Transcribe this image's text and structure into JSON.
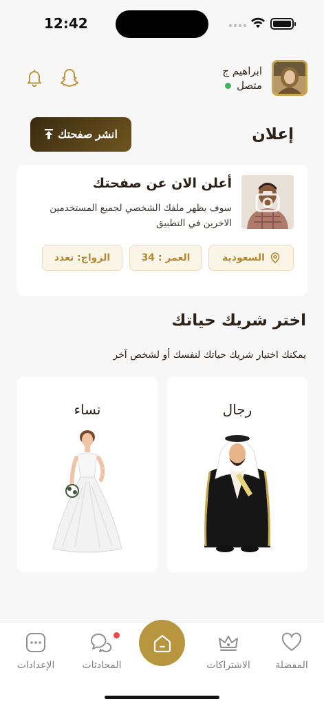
{
  "status_bar": {
    "time": "12:42"
  },
  "header": {
    "user_name": "ابراهيم ج",
    "user_status": "متصل",
    "icons": [
      "snapchat-icon",
      "bell-icon"
    ]
  },
  "ad_section": {
    "title": "إعلان",
    "publish_button": "انشر صفحتك",
    "card": {
      "heading": "أعلن الان عن صفحتك",
      "description": "سوف يظهر ملفك الشخصي لجميع المستخدمين الاخرين في التطبيق",
      "country": "السعودية",
      "age": "العمر : 34",
      "marriage": "الزواج: تعدد"
    }
  },
  "partner_section": {
    "title": "اختر شريك حياتك",
    "subtitle": "يمكنك اختيار شريك حياتك لنفسك أو لشخص آخر",
    "men_label": "رجال",
    "women_label": "نساء"
  },
  "tabbar": {
    "tabs": [
      {
        "label": "المفضلة",
        "icon": "heart-icon"
      },
      {
        "label": "الاشتراكات",
        "icon": "crown-icon"
      },
      {
        "label": "",
        "icon": "home-icon"
      },
      {
        "label": "المحادثات",
        "icon": "chat-icon"
      },
      {
        "label": "الإعدادات",
        "icon": "settings-icon"
      }
    ]
  },
  "colors": {
    "gold": "#b8963f",
    "dark_brown": "#3a2a10",
    "online": "#3db35a",
    "badge": "#ef4444"
  }
}
